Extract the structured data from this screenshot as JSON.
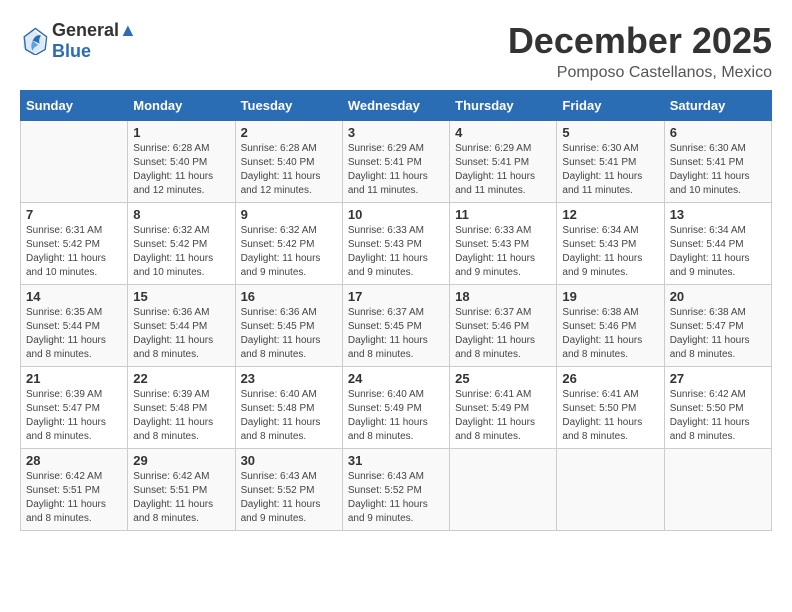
{
  "logo": {
    "line1": "General",
    "line2": "Blue"
  },
  "title": "December 2025",
  "location": "Pomposo Castellanos, Mexico",
  "days_of_week": [
    "Sunday",
    "Monday",
    "Tuesday",
    "Wednesday",
    "Thursday",
    "Friday",
    "Saturday"
  ],
  "weeks": [
    [
      {
        "day": "",
        "info": ""
      },
      {
        "day": "1",
        "info": "Sunrise: 6:28 AM\nSunset: 5:40 PM\nDaylight: 11 hours and 12 minutes."
      },
      {
        "day": "2",
        "info": "Sunrise: 6:28 AM\nSunset: 5:40 PM\nDaylight: 11 hours and 12 minutes."
      },
      {
        "day": "3",
        "info": "Sunrise: 6:29 AM\nSunset: 5:41 PM\nDaylight: 11 hours and 11 minutes."
      },
      {
        "day": "4",
        "info": "Sunrise: 6:29 AM\nSunset: 5:41 PM\nDaylight: 11 hours and 11 minutes."
      },
      {
        "day": "5",
        "info": "Sunrise: 6:30 AM\nSunset: 5:41 PM\nDaylight: 11 hours and 11 minutes."
      },
      {
        "day": "6",
        "info": "Sunrise: 6:30 AM\nSunset: 5:41 PM\nDaylight: 11 hours and 10 minutes."
      }
    ],
    [
      {
        "day": "7",
        "info": "Sunrise: 6:31 AM\nSunset: 5:42 PM\nDaylight: 11 hours and 10 minutes."
      },
      {
        "day": "8",
        "info": "Sunrise: 6:32 AM\nSunset: 5:42 PM\nDaylight: 11 hours and 10 minutes."
      },
      {
        "day": "9",
        "info": "Sunrise: 6:32 AM\nSunset: 5:42 PM\nDaylight: 11 hours and 9 minutes."
      },
      {
        "day": "10",
        "info": "Sunrise: 6:33 AM\nSunset: 5:43 PM\nDaylight: 11 hours and 9 minutes."
      },
      {
        "day": "11",
        "info": "Sunrise: 6:33 AM\nSunset: 5:43 PM\nDaylight: 11 hours and 9 minutes."
      },
      {
        "day": "12",
        "info": "Sunrise: 6:34 AM\nSunset: 5:43 PM\nDaylight: 11 hours and 9 minutes."
      },
      {
        "day": "13",
        "info": "Sunrise: 6:34 AM\nSunset: 5:44 PM\nDaylight: 11 hours and 9 minutes."
      }
    ],
    [
      {
        "day": "14",
        "info": "Sunrise: 6:35 AM\nSunset: 5:44 PM\nDaylight: 11 hours and 8 minutes."
      },
      {
        "day": "15",
        "info": "Sunrise: 6:36 AM\nSunset: 5:44 PM\nDaylight: 11 hours and 8 minutes."
      },
      {
        "day": "16",
        "info": "Sunrise: 6:36 AM\nSunset: 5:45 PM\nDaylight: 11 hours and 8 minutes."
      },
      {
        "day": "17",
        "info": "Sunrise: 6:37 AM\nSunset: 5:45 PM\nDaylight: 11 hours and 8 minutes."
      },
      {
        "day": "18",
        "info": "Sunrise: 6:37 AM\nSunset: 5:46 PM\nDaylight: 11 hours and 8 minutes."
      },
      {
        "day": "19",
        "info": "Sunrise: 6:38 AM\nSunset: 5:46 PM\nDaylight: 11 hours and 8 minutes."
      },
      {
        "day": "20",
        "info": "Sunrise: 6:38 AM\nSunset: 5:47 PM\nDaylight: 11 hours and 8 minutes."
      }
    ],
    [
      {
        "day": "21",
        "info": "Sunrise: 6:39 AM\nSunset: 5:47 PM\nDaylight: 11 hours and 8 minutes."
      },
      {
        "day": "22",
        "info": "Sunrise: 6:39 AM\nSunset: 5:48 PM\nDaylight: 11 hours and 8 minutes."
      },
      {
        "day": "23",
        "info": "Sunrise: 6:40 AM\nSunset: 5:48 PM\nDaylight: 11 hours and 8 minutes."
      },
      {
        "day": "24",
        "info": "Sunrise: 6:40 AM\nSunset: 5:49 PM\nDaylight: 11 hours and 8 minutes."
      },
      {
        "day": "25",
        "info": "Sunrise: 6:41 AM\nSunset: 5:49 PM\nDaylight: 11 hours and 8 minutes."
      },
      {
        "day": "26",
        "info": "Sunrise: 6:41 AM\nSunset: 5:50 PM\nDaylight: 11 hours and 8 minutes."
      },
      {
        "day": "27",
        "info": "Sunrise: 6:42 AM\nSunset: 5:50 PM\nDaylight: 11 hours and 8 minutes."
      }
    ],
    [
      {
        "day": "28",
        "info": "Sunrise: 6:42 AM\nSunset: 5:51 PM\nDaylight: 11 hours and 8 minutes."
      },
      {
        "day": "29",
        "info": "Sunrise: 6:42 AM\nSunset: 5:51 PM\nDaylight: 11 hours and 8 minutes."
      },
      {
        "day": "30",
        "info": "Sunrise: 6:43 AM\nSunset: 5:52 PM\nDaylight: 11 hours and 9 minutes."
      },
      {
        "day": "31",
        "info": "Sunrise: 6:43 AM\nSunset: 5:52 PM\nDaylight: 11 hours and 9 minutes."
      },
      {
        "day": "",
        "info": ""
      },
      {
        "day": "",
        "info": ""
      },
      {
        "day": "",
        "info": ""
      }
    ]
  ]
}
